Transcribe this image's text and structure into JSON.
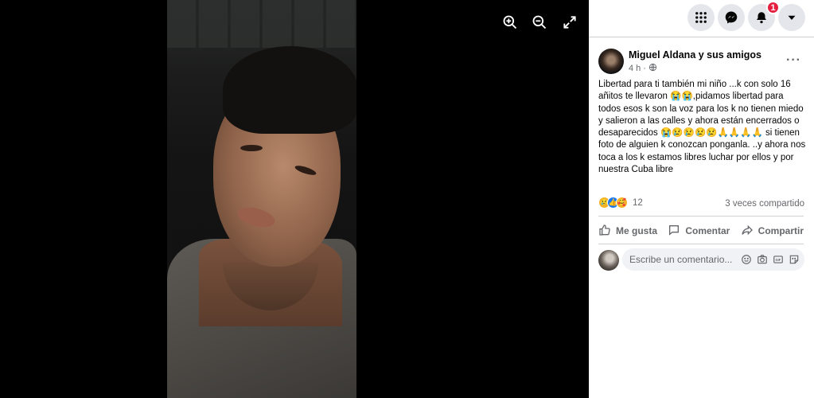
{
  "viewer": {
    "zoom_in_icon": "zoom-in-icon",
    "zoom_out_icon": "zoom-out-icon",
    "fullscreen_icon": "expand-icon"
  },
  "topbar": {
    "menu_icon": "grid-menu-icon",
    "messenger_icon": "messenger-icon",
    "notifications_icon": "bell-icon",
    "notifications_count": "1",
    "account_icon": "caret-down-icon"
  },
  "post": {
    "author": "Miguel Aldana y sus amigos",
    "time": "4 h",
    "separator": "·",
    "privacy_icon": "globe-icon",
    "text": "Libertad para ti también mi niño ...k con solo 16 añitos te llevaron 😭😭,pidamos libertad para todos esos k son la voz para los k no tienen miedo y salieron a las calles y ahora están encerrados o desaparecidos 😭😢😢😢😢🙏🙏🙏🙏 si tienen foto de alguien k conozcan ponganla. ..y ahora nos toca a los k estamos libres luchar por ellos y por nuestra Cuba libre",
    "reaction_count": "12",
    "shares": "3 veces compartido",
    "reactions": [
      "😢",
      "👍",
      "🥰"
    ]
  },
  "actions": {
    "like": "Me gusta",
    "comment": "Comentar",
    "share": "Compartir"
  },
  "comment": {
    "placeholder": "Escribe un comentario..."
  },
  "colors": {
    "accent": "#1877f2",
    "badge": "#e41e3f",
    "text_secondary": "#65676b"
  }
}
